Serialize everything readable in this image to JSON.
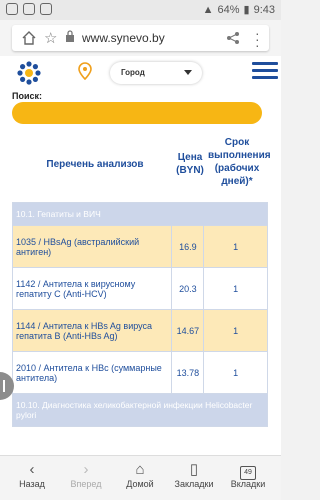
{
  "status": {
    "battery": "64%",
    "time": "9:43"
  },
  "browser": {
    "url": "www.synevo.by"
  },
  "header": {
    "city_placeholder": "Город"
  },
  "search": {
    "label": "Поиск:"
  },
  "table": {
    "col_name": "Перечень анализов",
    "col_price": "Цена (BYN)",
    "col_term": "Срок выполнения (рабочих дней)*",
    "group1": "10.1. Гепатиты и ВИЧ",
    "rows": [
      {
        "name": "1035 / HBsAg (австралийский антиген)",
        "price": "16.9",
        "term": "1"
      },
      {
        "name": "1142 / Антитела к вирусному гепатиту С (Anti-HCV)",
        "price": "20.3",
        "term": "1"
      },
      {
        "name": "1144 / Антитела к HBs Ag вируса гепатита В (Anti-HBs Ag)",
        "price": "14.67",
        "term": "1"
      },
      {
        "name": "2010 / Антитела к HBc (суммарные антитела)",
        "price": "13.78",
        "term": "1"
      }
    ],
    "group2": "10.10. Диагностика хеликобактерной инфекции Helicobacter pylori"
  },
  "bottom_nav": {
    "back": "Назад",
    "forward": "Вперед",
    "home": "Домой",
    "bookmarks": "Закладки",
    "tabs": "Вкладки",
    "tab_count": "49"
  },
  "colors": {
    "brand_blue": "#1f4e9c",
    "accent_yellow": "#f7b614",
    "group_bg": "#ccd6ea",
    "row_alt": "#fde9b8"
  }
}
